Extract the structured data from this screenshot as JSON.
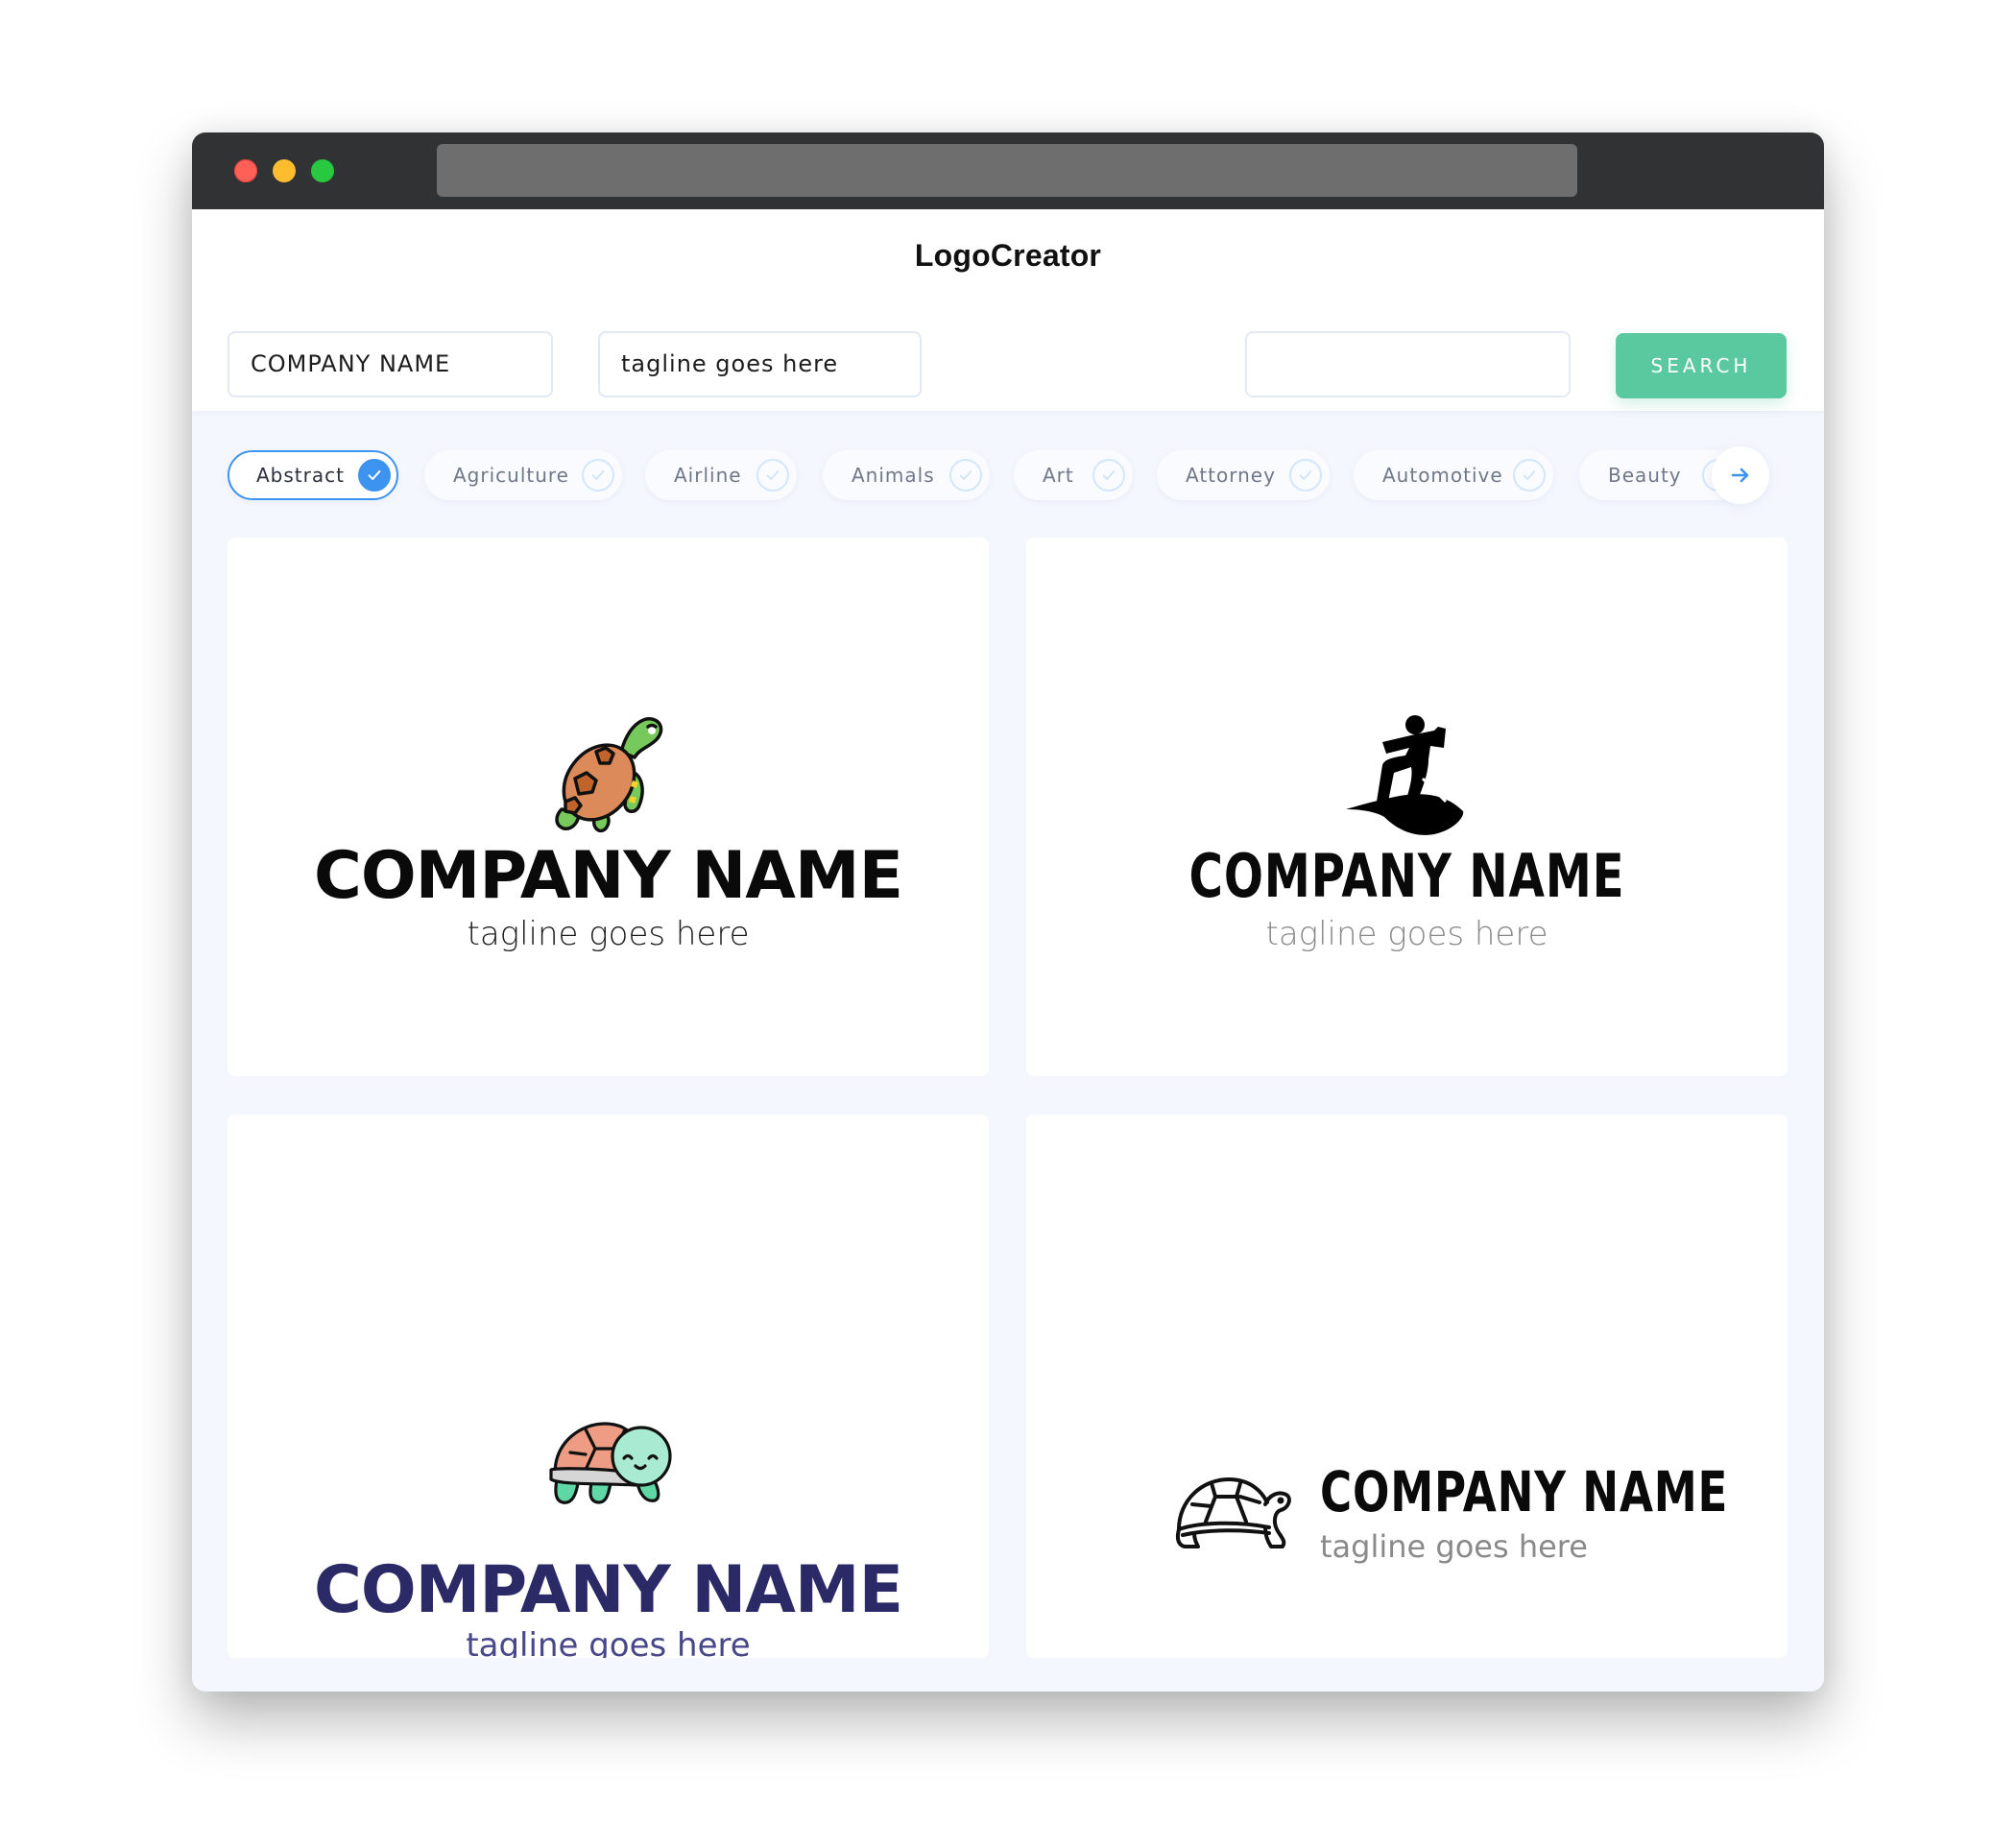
{
  "app": {
    "title": "LogoCreator"
  },
  "window": {
    "controls": [
      "close",
      "minimize",
      "maximize"
    ]
  },
  "search": {
    "company_value": "COMPANY NAME",
    "tagline_value": "tagline goes here",
    "keyword_value": "",
    "button_label": "SEARCH"
  },
  "categories": [
    {
      "label": "Abstract",
      "selected": true
    },
    {
      "label": "Agriculture",
      "selected": false
    },
    {
      "label": "Airline",
      "selected": false
    },
    {
      "label": "Animals",
      "selected": false
    },
    {
      "label": "Art",
      "selected": false
    },
    {
      "label": "Attorney",
      "selected": false
    },
    {
      "label": "Automotive",
      "selected": false
    },
    {
      "label": "Beauty",
      "selected": false
    }
  ],
  "next_icon": "arrow-right-icon",
  "logos": [
    {
      "icon": "sea-turtle-color-icon",
      "company": "COMPANY NAME",
      "tagline": "tagline goes here",
      "company_color": "#0a0a0a",
      "tagline_color": "#1e1e1e"
    },
    {
      "icon": "surfer-silhouette-icon",
      "company": "COMPANY NAME",
      "tagline": "tagline goes here",
      "company_color": "#0a0a0a",
      "tagline_color": "#8a8a8a"
    },
    {
      "icon": "cute-turtle-icon",
      "company": "COMPANY NAME",
      "tagline": "tagline goes here",
      "company_color": "#2b2a66",
      "tagline_color": "#48478a"
    },
    {
      "icon": "turtle-outline-icon",
      "company": "COMPANY NAME",
      "tagline": "tagline goes here",
      "company_color": "#0a0a0a",
      "tagline_color": "#8a8a8a"
    }
  ],
  "colors": {
    "accent_blue": "#3d93f0",
    "search_green": "#5bc9a0",
    "titlebar": "#313234",
    "page_bg": "#f4f7fd"
  }
}
